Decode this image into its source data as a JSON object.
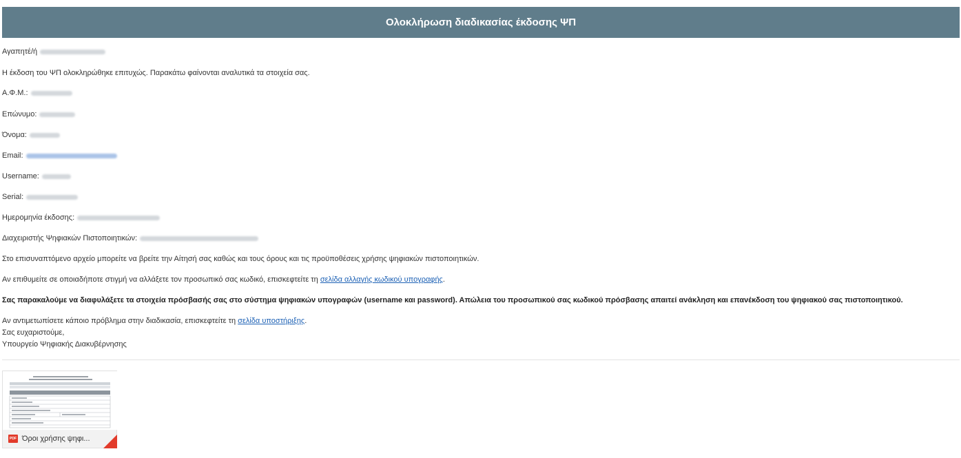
{
  "colors": {
    "header_bg": "#607d8b",
    "link": "#1a5fb4",
    "blur": "#d4d8dc",
    "blur_link": "#aac4e8",
    "pdf": "#e23b2b"
  },
  "header": {
    "title": "Ολοκλήρωση διαδικασίας έκδοσης ΨΠ"
  },
  "body": {
    "greeting": "Αγαπητέ/ή",
    "intro": "Η έκδοση του ΨΠ ολοκληρώθηκε επιτυχώς. Παρακάτω φαίνονται αναλυτικά τα στοιχεία σας.",
    "fields": [
      {
        "label": "Α.Φ.Μ.:"
      },
      {
        "label": "Επώνυμο:"
      },
      {
        "label": "Όνομα:"
      },
      {
        "label": "Email:"
      },
      {
        "label": "Username:"
      },
      {
        "label": "Serial:"
      },
      {
        "label": "Ημερομηνία έκδοσης:"
      },
      {
        "label": "Διαχειριστής Ψηφιακών Πιστοποιητικών:"
      }
    ],
    "attachment_note": "Στο επισυναπτόμενο αρχείο μπορείτε να βρείτε την Αίτησή σας καθώς και τους όρους και τις προϋποθέσεις χρήσης ψηφιακών πιστοποιητικών.",
    "password_text": "Αν επιθυμείτε σε οποιαδήποτε στιγμή να αλλάξετε τον προσωπικό σας κωδικό, επισκεφτείτε τη",
    "password_link": "σελίδα αλλαγής κωδικού υπογραφής",
    "warning": "Σας παρακαλούμε να διαφυλάξετε τα στοιχεία πρόσβασής σας στο σύστημα ψηφιακών υπογραφών (username και password). Απώλεια του προσωπικού σας κωδικού πρόσβασης απαιτεί ανάκληση και επανέκδοση του ψηφιακού σας πιστοποιητικού.",
    "support_text": "Αν αντιμετωπίσετε κάποιο πρόβλημα στην διαδικασία, επισκεφτείτε τη",
    "support_link": "σελίδα υποστήριξης",
    "thanks": "Σας ευχαριστούμε,",
    "signature": "Υπουργείο Ψηφιακής Διακυβέρνησης"
  },
  "attachment": {
    "icon_label": "PDF",
    "filename": "Όροι χρήσης ψηφι..."
  }
}
